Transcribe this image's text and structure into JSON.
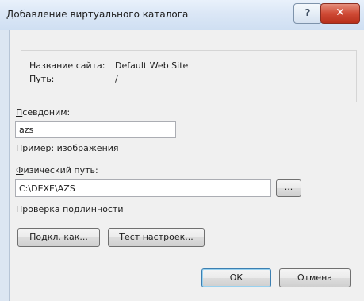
{
  "window": {
    "title": "Добавление виртуального каталога",
    "help_label": "?",
    "close_label": "✕"
  },
  "site_info": {
    "site_name_label": "Название сайта:",
    "site_name_value": "Default Web Site",
    "path_label": "Путь:",
    "path_value": "/"
  },
  "alias": {
    "label_mnemonic": "П",
    "label_rest": "севдоним:",
    "value": "azs",
    "example": "Пример: изображения"
  },
  "physical_path": {
    "label_mnemonic": "Ф",
    "label_rest": "изический путь:",
    "value": "C:\\DEXE\\AZS",
    "browse_label": "..."
  },
  "auth": {
    "label": "Проверка подлинности",
    "connect_as": {
      "pre": "Подкл",
      "mnemonic": ".",
      "post": " как..."
    },
    "test_settings": {
      "pre": "Тест ",
      "mnemonic": "н",
      "post": "астроек..."
    }
  },
  "footer": {
    "ok_label": "ОК",
    "cancel_label": "Отмена"
  }
}
